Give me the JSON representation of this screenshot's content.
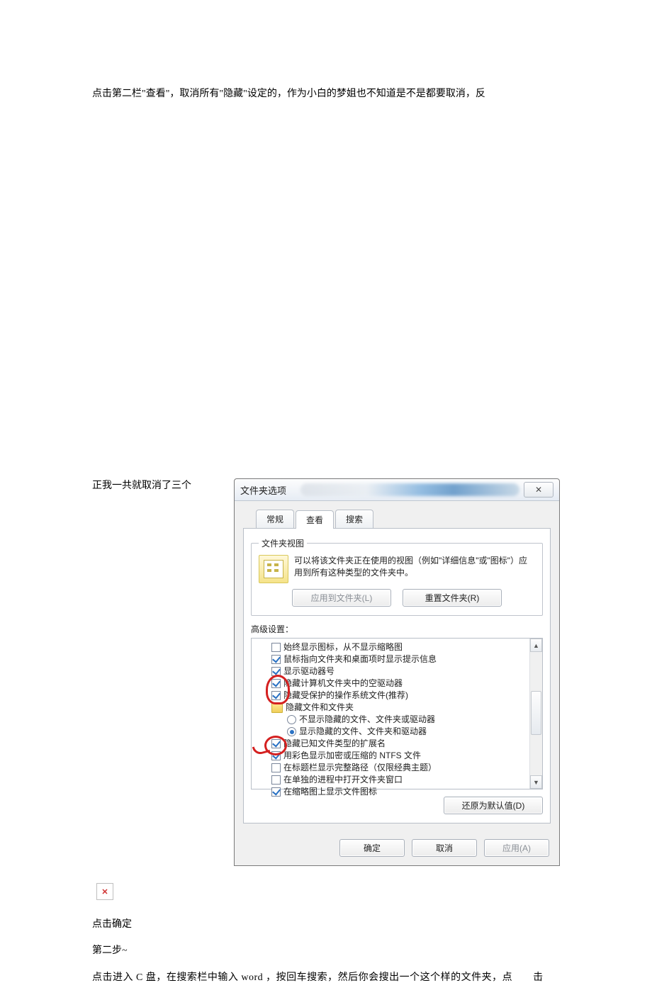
{
  "doc": {
    "para_top": "点击第二栏\"查看\"，取消所有\"隐藏\"设定的，作为小白的梦姐也不知道是不是都要取消，反",
    "para_after_three": "正我一共就取消了三个",
    "para_confirm": "点击确定",
    "para_step2": "第二步~",
    "para_cdrive": "点击进入 C 盘，在搜索栏中输入 word ，按回车搜索，然后你会搜出一个这个样的文件夹，点  击"
  },
  "dialog": {
    "title": "文件夹选项",
    "close_glyph": "✕",
    "tabs": {
      "general": "常规",
      "view": "查看",
      "search": "搜索"
    },
    "folderview": {
      "legend": "文件夹视图",
      "desc": "可以将该文件夹正在使用的视图（例如\"详细信息\"或\"图标\"）应用到所有这种类型的文件夹中。",
      "apply_btn": "应用到文件夹(L)",
      "reset_btn": "重置文件夹(R)"
    },
    "advanced": {
      "label": "高级设置：",
      "items": [
        {
          "type": "chk",
          "checked": false,
          "text": "始终显示图标，从不显示缩略图"
        },
        {
          "type": "chk",
          "checked": true,
          "text": "鼠标指向文件夹和桌面项时显示提示信息"
        },
        {
          "type": "chk",
          "checked": true,
          "text": "显示驱动器号"
        },
        {
          "type": "chk",
          "checked": true,
          "text": "隐藏计算机文件夹中的空驱动器"
        },
        {
          "type": "chk",
          "checked": true,
          "text": "隐藏受保护的操作系统文件(推荐)"
        },
        {
          "type": "folder",
          "text": "隐藏文件和文件夹"
        },
        {
          "type": "rdo",
          "selected": false,
          "sub": true,
          "text": "不显示隐藏的文件、文件夹或驱动器"
        },
        {
          "type": "rdo",
          "selected": true,
          "sub": true,
          "text": "显示隐藏的文件、文件夹和驱动器"
        },
        {
          "type": "chk",
          "checked": true,
          "text": "隐藏已知文件类型的扩展名"
        },
        {
          "type": "chk",
          "checked": true,
          "text": "用彩色显示加密或压缩的 NTFS 文件"
        },
        {
          "type": "chk",
          "checked": false,
          "text": "在标题栏显示完整路径（仅限经典主题）"
        },
        {
          "type": "chk",
          "checked": false,
          "text": "在单独的进程中打开文件夹窗口"
        },
        {
          "type": "chk",
          "checked": true,
          "text": "在缩略图上显示文件图标"
        }
      ],
      "restore_btn": "还原为默认值(D)"
    },
    "footer": {
      "ok": "确定",
      "cancel": "取消",
      "apply": "应用(A)"
    }
  }
}
